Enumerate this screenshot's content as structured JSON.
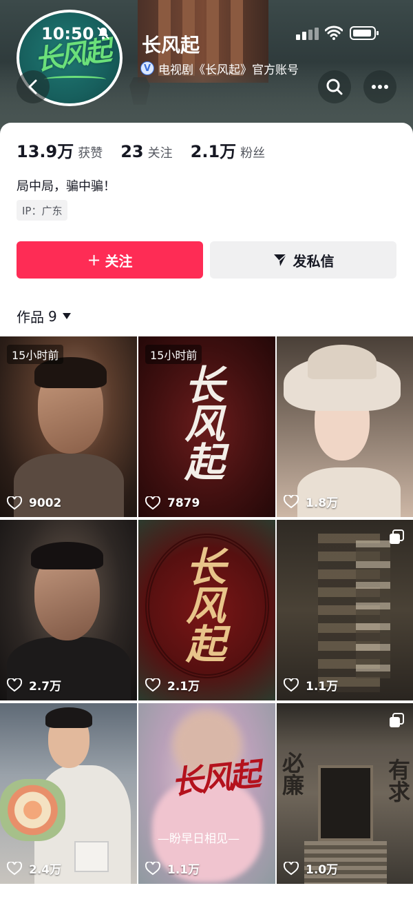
{
  "status_bar": {
    "time": "10:50"
  },
  "header": {
    "avatar_text": "长风起",
    "account_name": "长风起",
    "verify_mark": "V",
    "verify_text": "电视剧《长风起》官方账号"
  },
  "stats": [
    {
      "num": "13.9万",
      "label": "获赞"
    },
    {
      "num": "23",
      "label": "关注"
    },
    {
      "num": "2.1万",
      "label": "粉丝"
    }
  ],
  "bio": "局中局，骗中骗！",
  "ip": "IP：广东",
  "actions": {
    "follow_plus": "+",
    "follow_label": "关注",
    "message_label": "发私信"
  },
  "works": {
    "label": "作品",
    "count": "9"
  },
  "videos": [
    {
      "ago": "15小时前",
      "likes": "9002"
    },
    {
      "ago": "15小时前",
      "likes": "7879",
      "title": "长风起"
    },
    {
      "likes": "1.8万"
    },
    {
      "likes": "2.7万"
    },
    {
      "likes": "2.1万",
      "title": "长风起"
    },
    {
      "likes": "1.1万"
    },
    {
      "likes": "2.4万"
    },
    {
      "likes": "1.1万",
      "title": "长风起",
      "subtitle": "—盼早日相见—"
    },
    {
      "likes": "1.0万",
      "left_text": "必廉",
      "right_text": "有求"
    }
  ],
  "colors": {
    "accent": "#fe2c55",
    "avatar_bg": "#175f5d",
    "logo_green": "#6be07a"
  }
}
